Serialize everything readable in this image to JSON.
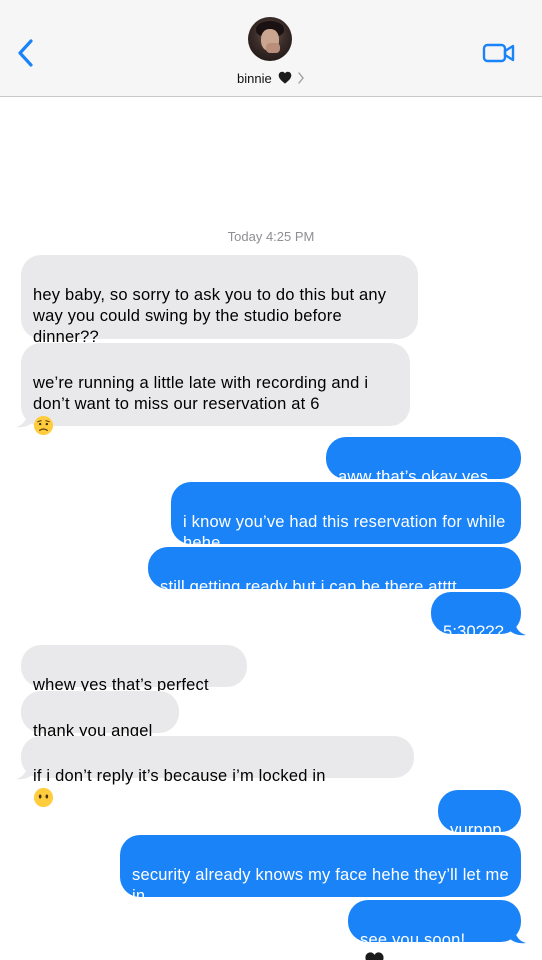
{
  "header": {
    "contact_name": "binnie",
    "heart_emoji": "black-heart",
    "back_icon": "chevron-left-icon",
    "video_icon": "video-camera-icon",
    "accent": "#1a83f7"
  },
  "thread": {
    "timestamp": "Today 4:25 PM",
    "messages": [
      {
        "dir": "in",
        "text": "hey baby, so sorry to ask you to do this but any way you could swing by the studio before dinner??"
      },
      {
        "dir": "in",
        "text": "we’re running a little late with recording and i don’t want to miss our reservation at 6",
        "emoji": "worried-face"
      },
      {
        "dir": "out",
        "text": "aww that’s okay yes"
      },
      {
        "dir": "out",
        "text": "i know you’ve had this reservation for while hehe"
      },
      {
        "dir": "out",
        "text": "still getting ready but i can be there atttt"
      },
      {
        "dir": "out",
        "text": "5:30???"
      },
      {
        "dir": "in",
        "text": "whew yes that’s perfect"
      },
      {
        "dir": "in",
        "text": "thank you angel"
      },
      {
        "dir": "in",
        "text": "if i don’t reply it’s because i’m locked in",
        "emoji": "no-mouth-face"
      },
      {
        "dir": "out",
        "text": "yurppp"
      },
      {
        "dir": "out",
        "text": "security already knows my face hehe they’ll let me in"
      },
      {
        "dir": "out",
        "text": "see you soon!",
        "emoji": "black-heart"
      }
    ],
    "colors": {
      "incoming": "#e9e9eb",
      "outgoing": "#1a83f7"
    }
  }
}
